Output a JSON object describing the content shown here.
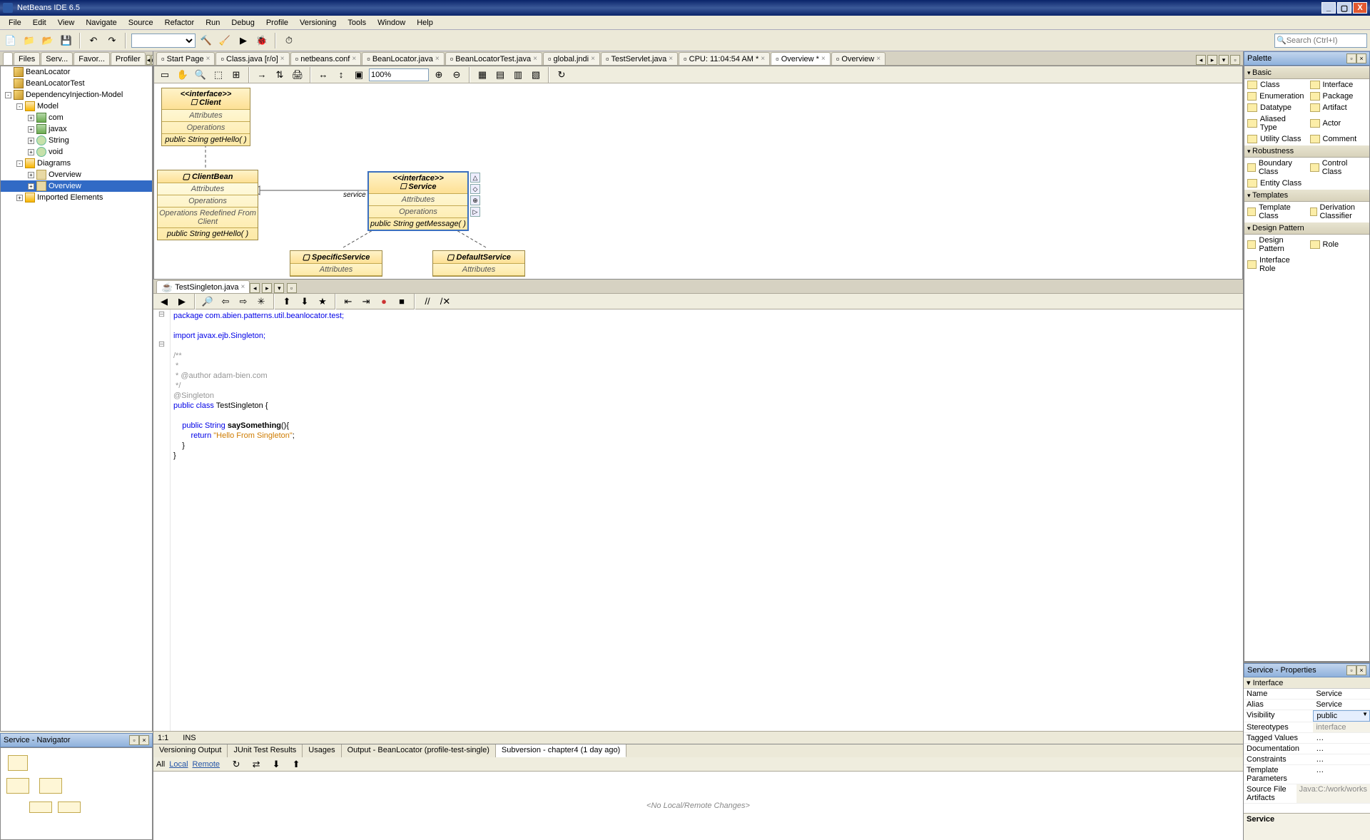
{
  "title": "NetBeans IDE 6.5",
  "menubar": [
    "File",
    "Edit",
    "View",
    "Navigate",
    "Source",
    "Refactor",
    "Run",
    "Debug",
    "Profile",
    "Versioning",
    "Tools",
    "Window",
    "Help"
  ],
  "search_placeholder": "Search (Ctrl+I)",
  "left_tabs": [
    "",
    "Files",
    "Serv...",
    "Favor...",
    "Profiler"
  ],
  "projects_tree": [
    {
      "depth": 0,
      "expand": "",
      "icon": "cube",
      "label": "BeanLocator"
    },
    {
      "depth": 0,
      "expand": "",
      "icon": "cube",
      "label": "BeanLocatorTest"
    },
    {
      "depth": 0,
      "expand": "-",
      "icon": "cube",
      "label": "DependencyInjection-Model"
    },
    {
      "depth": 1,
      "expand": "-",
      "icon": "folder",
      "label": "Model"
    },
    {
      "depth": 2,
      "expand": "+",
      "icon": "pkg",
      "label": "com"
    },
    {
      "depth": 2,
      "expand": "+",
      "icon": "pkg",
      "label": "javax"
    },
    {
      "depth": 2,
      "expand": "+",
      "icon": "class",
      "label": "String"
    },
    {
      "depth": 2,
      "expand": "+",
      "icon": "class",
      "label": "void"
    },
    {
      "depth": 1,
      "expand": "-",
      "icon": "folder",
      "label": "Diagrams"
    },
    {
      "depth": 2,
      "expand": "+",
      "icon": "diagram",
      "label": "Overview"
    },
    {
      "depth": 2,
      "expand": "+",
      "icon": "diagram",
      "label": "Overview",
      "selected": true
    },
    {
      "depth": 1,
      "expand": "+",
      "icon": "folder",
      "label": "Imported Elements"
    }
  ],
  "navigator_title": "Service - Navigator",
  "editor_tabs": [
    {
      "label": "Start Page"
    },
    {
      "label": "Class.java [r/o]"
    },
    {
      "label": "netbeans.conf"
    },
    {
      "label": "BeanLocator.java"
    },
    {
      "label": "BeanLocatorTest.java"
    },
    {
      "label": "global.jndi"
    },
    {
      "label": "TestServlet.java"
    },
    {
      "label": "CPU: 11:04:54 AM *"
    },
    {
      "label": "Overview *",
      "active": true
    },
    {
      "label": "Overview"
    }
  ],
  "zoom": "100%",
  "uml": {
    "client": {
      "stereo": "<<interface>>",
      "name": "Client",
      "attrs": "Attributes",
      "ops": "Operations",
      "op1": "public String  getHello(  )"
    },
    "clientbean": {
      "name": "ClientBean",
      "attrs": "Attributes",
      "ops": "Operations",
      "redef": "Operations Redefined From Client",
      "op1": "public String  getHello(  )"
    },
    "service": {
      "stereo": "<<interface>>",
      "name": "Service",
      "attrs": "Attributes",
      "ops": "Operations",
      "op1": "public String  getMessage(  )",
      "assoc": "service"
    },
    "specific": {
      "name": "SpecificService",
      "attrs": "Attributes"
    },
    "default": {
      "name": "DefaultService",
      "attrs": "Attributes"
    }
  },
  "inner_tab": "TestSingleton.java",
  "code": {
    "pkg": "package com.abien.patterns.util.beanlocator.test;",
    "imp": "import javax.ejb.Singleton;",
    "c1": "/**",
    "c2": " *",
    "c3": " * @author adam-bien.com",
    "c4": " */",
    "anno": "@Singleton",
    "cls_pre": "public class ",
    "cls_name": "TestSingleton",
    "cls_post": " {",
    "m_pre": "    public String ",
    "m_name": "saySomething",
    "m_post": "(){",
    "ret_pre": "        return ",
    "ret_str": "\"Hello From Singleton\"",
    "ret_post": ";",
    "close1": "    }",
    "close2": "}"
  },
  "editor_status": {
    "pos": "1:1",
    "mode": "INS"
  },
  "bottom_tabs": [
    "Versioning Output",
    "JUnit Test Results",
    "Usages",
    "Output - BeanLocator (profile-test-single)",
    "Subversion - chapter4 (1 day ago)"
  ],
  "vcs": {
    "filters": [
      "All",
      "Local",
      "Remote"
    ],
    "body": "<No Local/Remote Changes>"
  },
  "palette_title": "Palette",
  "palette": {
    "Basic": [
      "Class",
      "Interface",
      "Enumeration",
      "Package",
      "Datatype",
      "Artifact",
      "Aliased Type",
      "Actor",
      "Utility Class",
      "Comment"
    ],
    "Robustness": [
      "Boundary Class",
      "Control Class",
      "Entity Class"
    ],
    "Templates": [
      "Template Class",
      "Derivation Classifier"
    ],
    "Design Pattern": [
      "Design Pattern",
      "Role",
      "Interface Role"
    ]
  },
  "properties_title": "Service - Properties",
  "properties_group": "Interface",
  "properties": [
    {
      "k": "Name",
      "v": "Service"
    },
    {
      "k": "Alias",
      "v": "Service"
    },
    {
      "k": "Visibility",
      "v": "public",
      "combo": true
    },
    {
      "k": "Stereotypes",
      "v": "interface",
      "ro": true
    },
    {
      "k": "Tagged Values",
      "v": "",
      "ell": true
    },
    {
      "k": "Documentation",
      "v": "",
      "ell": true
    },
    {
      "k": "Constraints",
      "v": "",
      "ell": true
    },
    {
      "k": "Template Parameters",
      "v": "",
      "ell": true
    },
    {
      "k": "Source File Artifacts",
      "v": "Java:C:/work/works",
      "ro": true
    }
  ],
  "svc_footer": "Service"
}
